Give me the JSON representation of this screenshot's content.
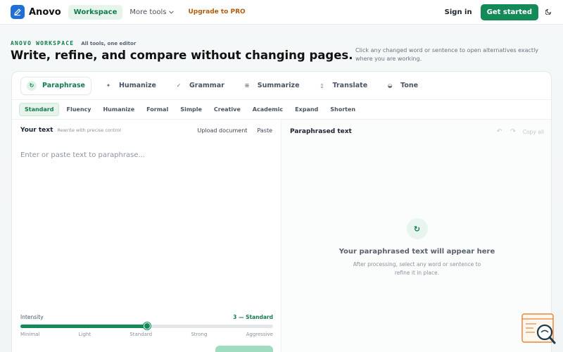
{
  "nav": {
    "brand": "Anovo",
    "workspace": "Workspace",
    "more_tools": "More tools",
    "upgrade": "Upgrade to PRO",
    "sign_in": "Sign in",
    "get_started": "Get started"
  },
  "hero": {
    "kicker": "ANOVO WORKSPACE",
    "kicker_sub": "All tools, one editor",
    "headline": "Write, refine, and compare without changing pages.",
    "hint": "Click any changed word or sentence to open alternatives exactly where you are working."
  },
  "tools": [
    {
      "label": "Paraphrase",
      "icon": "↻"
    },
    {
      "label": "Humanize",
      "icon": "✦"
    },
    {
      "label": "Grammar",
      "icon": "✓"
    },
    {
      "label": "Summarize",
      "icon": "≡"
    },
    {
      "label": "Translate",
      "icon": "▯"
    },
    {
      "label": "Tone",
      "icon": "◒"
    }
  ],
  "modes": [
    "Standard",
    "Fluency",
    "Humanize",
    "Formal",
    "Simple",
    "Creative",
    "Academic",
    "Expand",
    "Shorten"
  ],
  "input_pane": {
    "title": "Your text",
    "subtitle": "Rewrite with precise control",
    "upload": "Upload document",
    "paste": "Paste",
    "placeholder": "Enter or paste text to paraphrase..."
  },
  "intensity": {
    "label": "Intensity",
    "value_label": "3 — Standard",
    "level": 0.5,
    "ticks": [
      "Minimal",
      "Light",
      "Standard",
      "Strong",
      "Aggressive"
    ]
  },
  "output_pane": {
    "title": "Paraphrased text",
    "undo_icon": "↶",
    "redo_icon": "↷",
    "copy_all": "Copy all",
    "empty_icon": "↻",
    "empty_title": "Your paraphrased text will appear here",
    "empty_desc": "After processing, select any word or sentence to refine it in place."
  },
  "colors": {
    "accent": "#138a57",
    "accent_soft": "#e6f4ec",
    "pro": "#b45b0a",
    "logo": "#1f6fd6",
    "help_widget": "#e8873a"
  },
  "icons": {
    "logo": "pen-icon",
    "more_tools": "chevron-down-icon",
    "theme": "moon-icon",
    "help": "help-search-icon"
  }
}
